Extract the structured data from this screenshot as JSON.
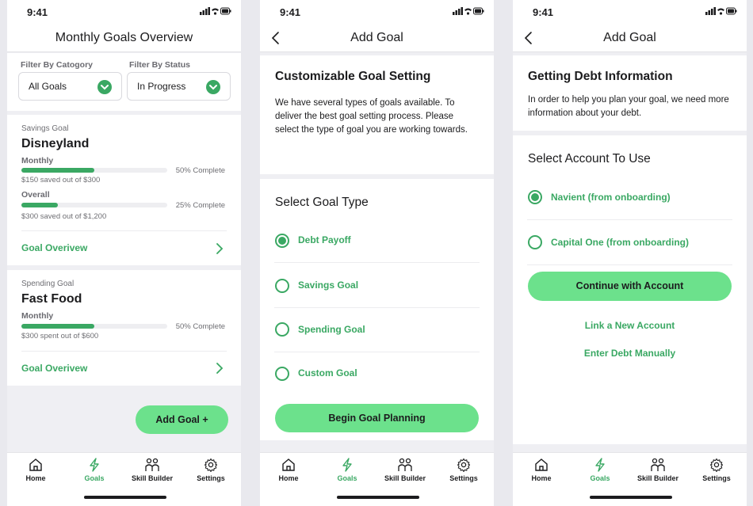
{
  "status": {
    "time": "9:41"
  },
  "tabs": [
    {
      "label": "Home",
      "icon": "home-icon"
    },
    {
      "label": "Goals",
      "icon": "lightning-icon"
    },
    {
      "label": "Skill Builder",
      "icon": "people-icon"
    },
    {
      "label": "Settings",
      "icon": "gear-icon"
    }
  ],
  "colors": {
    "accent": "#3aa863",
    "button": "#6ce18c"
  },
  "screen1": {
    "title": "Monthly Goals Overview",
    "filter_category_label": "Filter By Catogory",
    "filter_category_value": "All Goals",
    "filter_status_label": "Filter By Status",
    "filter_status_value": "In Progress",
    "goals": [
      {
        "type": "Savings Goal",
        "name": "Disneyland",
        "progress": [
          {
            "label": "Monthly",
            "percent": 50,
            "percent_text": "50% Complete",
            "detail": "$150 saved out of $300"
          },
          {
            "label": "Overall",
            "percent": 25,
            "percent_text": "25% Complete",
            "detail": "$300 saved out of $1,200"
          }
        ],
        "link": "Goal Overivew"
      },
      {
        "type": "Spending Goal",
        "name": "Fast Food",
        "progress": [
          {
            "label": "Monthly",
            "percent": 50,
            "percent_text": "50% Complete",
            "detail": "$300 spent out of $600"
          }
        ],
        "link": "Goal Overivew"
      }
    ],
    "add_button": "Add Goal +"
  },
  "screen2": {
    "title": "Add Goal",
    "heading": "Customizable Goal Setting",
    "description": "We have several types of goals available. To deliver the best goal setting process. Please select the type of goal you are working towards.",
    "select_heading": "Select Goal Type",
    "options": [
      {
        "label": "Debt Payoff",
        "selected": true
      },
      {
        "label": "Savings Goal",
        "selected": false
      },
      {
        "label": "Spending Goal",
        "selected": false
      },
      {
        "label": "Custom Goal",
        "selected": false
      }
    ],
    "button": "Begin Goal Planning"
  },
  "screen3": {
    "title": "Add Goal",
    "heading": "Getting Debt Information",
    "description": "In order to help you plan your goal, we need more information about your debt.",
    "select_heading": "Select Account To Use",
    "options": [
      {
        "label": "Navient (from onboarding)",
        "selected": true
      },
      {
        "label": "Capital One (from onboarding)",
        "selected": false
      }
    ],
    "button": "Continue with Account",
    "link_new": "Link a New Account",
    "link_manual": "Enter Debt Manually"
  }
}
